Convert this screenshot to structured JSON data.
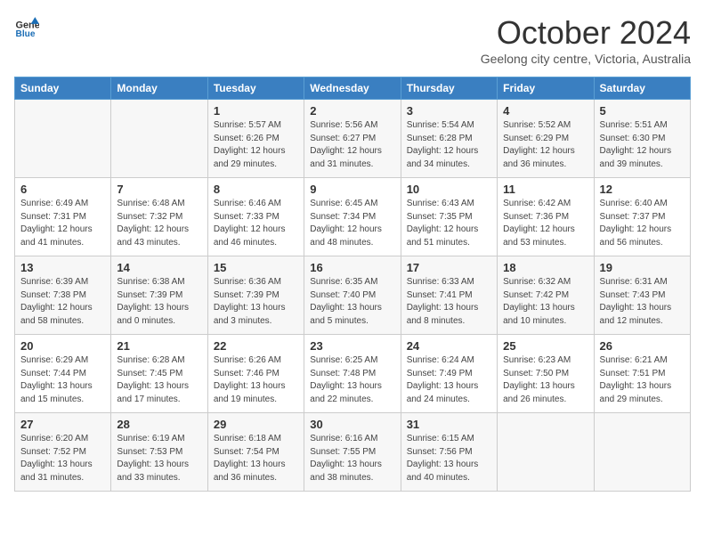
{
  "header": {
    "logo_line1": "General",
    "logo_line2": "Blue",
    "month": "October 2024",
    "location": "Geelong city centre, Victoria, Australia"
  },
  "days_of_week": [
    "Sunday",
    "Monday",
    "Tuesday",
    "Wednesday",
    "Thursday",
    "Friday",
    "Saturday"
  ],
  "weeks": [
    [
      {
        "day": "",
        "info": ""
      },
      {
        "day": "",
        "info": ""
      },
      {
        "day": "1",
        "info": "Sunrise: 5:57 AM\nSunset: 6:26 PM\nDaylight: 12 hours\nand 29 minutes."
      },
      {
        "day": "2",
        "info": "Sunrise: 5:56 AM\nSunset: 6:27 PM\nDaylight: 12 hours\nand 31 minutes."
      },
      {
        "day": "3",
        "info": "Sunrise: 5:54 AM\nSunset: 6:28 PM\nDaylight: 12 hours\nand 34 minutes."
      },
      {
        "day": "4",
        "info": "Sunrise: 5:52 AM\nSunset: 6:29 PM\nDaylight: 12 hours\nand 36 minutes."
      },
      {
        "day": "5",
        "info": "Sunrise: 5:51 AM\nSunset: 6:30 PM\nDaylight: 12 hours\nand 39 minutes."
      }
    ],
    [
      {
        "day": "6",
        "info": "Sunrise: 6:49 AM\nSunset: 7:31 PM\nDaylight: 12 hours\nand 41 minutes."
      },
      {
        "day": "7",
        "info": "Sunrise: 6:48 AM\nSunset: 7:32 PM\nDaylight: 12 hours\nand 43 minutes."
      },
      {
        "day": "8",
        "info": "Sunrise: 6:46 AM\nSunset: 7:33 PM\nDaylight: 12 hours\nand 46 minutes."
      },
      {
        "day": "9",
        "info": "Sunrise: 6:45 AM\nSunset: 7:34 PM\nDaylight: 12 hours\nand 48 minutes."
      },
      {
        "day": "10",
        "info": "Sunrise: 6:43 AM\nSunset: 7:35 PM\nDaylight: 12 hours\nand 51 minutes."
      },
      {
        "day": "11",
        "info": "Sunrise: 6:42 AM\nSunset: 7:36 PM\nDaylight: 12 hours\nand 53 minutes."
      },
      {
        "day": "12",
        "info": "Sunrise: 6:40 AM\nSunset: 7:37 PM\nDaylight: 12 hours\nand 56 minutes."
      }
    ],
    [
      {
        "day": "13",
        "info": "Sunrise: 6:39 AM\nSunset: 7:38 PM\nDaylight: 12 hours\nand 58 minutes."
      },
      {
        "day": "14",
        "info": "Sunrise: 6:38 AM\nSunset: 7:39 PM\nDaylight: 13 hours\nand 0 minutes."
      },
      {
        "day": "15",
        "info": "Sunrise: 6:36 AM\nSunset: 7:39 PM\nDaylight: 13 hours\nand 3 minutes."
      },
      {
        "day": "16",
        "info": "Sunrise: 6:35 AM\nSunset: 7:40 PM\nDaylight: 13 hours\nand 5 minutes."
      },
      {
        "day": "17",
        "info": "Sunrise: 6:33 AM\nSunset: 7:41 PM\nDaylight: 13 hours\nand 8 minutes."
      },
      {
        "day": "18",
        "info": "Sunrise: 6:32 AM\nSunset: 7:42 PM\nDaylight: 13 hours\nand 10 minutes."
      },
      {
        "day": "19",
        "info": "Sunrise: 6:31 AM\nSunset: 7:43 PM\nDaylight: 13 hours\nand 12 minutes."
      }
    ],
    [
      {
        "day": "20",
        "info": "Sunrise: 6:29 AM\nSunset: 7:44 PM\nDaylight: 13 hours\nand 15 minutes."
      },
      {
        "day": "21",
        "info": "Sunrise: 6:28 AM\nSunset: 7:45 PM\nDaylight: 13 hours\nand 17 minutes."
      },
      {
        "day": "22",
        "info": "Sunrise: 6:26 AM\nSunset: 7:46 PM\nDaylight: 13 hours\nand 19 minutes."
      },
      {
        "day": "23",
        "info": "Sunrise: 6:25 AM\nSunset: 7:48 PM\nDaylight: 13 hours\nand 22 minutes."
      },
      {
        "day": "24",
        "info": "Sunrise: 6:24 AM\nSunset: 7:49 PM\nDaylight: 13 hours\nand 24 minutes."
      },
      {
        "day": "25",
        "info": "Sunrise: 6:23 AM\nSunset: 7:50 PM\nDaylight: 13 hours\nand 26 minutes."
      },
      {
        "day": "26",
        "info": "Sunrise: 6:21 AM\nSunset: 7:51 PM\nDaylight: 13 hours\nand 29 minutes."
      }
    ],
    [
      {
        "day": "27",
        "info": "Sunrise: 6:20 AM\nSunset: 7:52 PM\nDaylight: 13 hours\nand 31 minutes."
      },
      {
        "day": "28",
        "info": "Sunrise: 6:19 AM\nSunset: 7:53 PM\nDaylight: 13 hours\nand 33 minutes."
      },
      {
        "day": "29",
        "info": "Sunrise: 6:18 AM\nSunset: 7:54 PM\nDaylight: 13 hours\nand 36 minutes."
      },
      {
        "day": "30",
        "info": "Sunrise: 6:16 AM\nSunset: 7:55 PM\nDaylight: 13 hours\nand 38 minutes."
      },
      {
        "day": "31",
        "info": "Sunrise: 6:15 AM\nSunset: 7:56 PM\nDaylight: 13 hours\nand 40 minutes."
      },
      {
        "day": "",
        "info": ""
      },
      {
        "day": "",
        "info": ""
      }
    ]
  ]
}
